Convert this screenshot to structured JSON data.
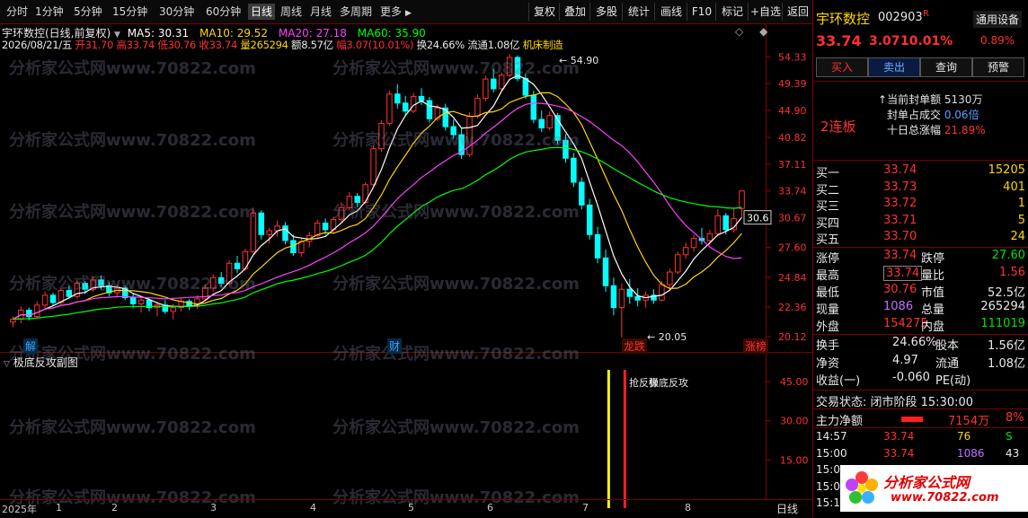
{
  "toolbar": {
    "periods": [
      "分时",
      "1分钟",
      "5分钟",
      "15分钟",
      "30分钟",
      "60分钟",
      "日线",
      "周线",
      "月线",
      "多周期",
      "更多"
    ],
    "active": "日线",
    "more_arrow": "▶",
    "actions": [
      "复权",
      "叠加",
      "多股",
      "统计",
      "画线",
      "F10",
      "标记",
      "+自选",
      "返回"
    ]
  },
  "chart": {
    "title": "宇环数控(日线,前复权)",
    "ma": [
      {
        "label": "MA5: 30.31",
        "color": "#ffffff"
      },
      {
        "label": "MA10: 29.52",
        "color": "#ffd700"
      },
      {
        "label": "MA20: 27.18",
        "color": "#ff40ff"
      },
      {
        "label": "MA60: 35.90",
        "color": "#00ff00"
      }
    ],
    "info_date": "2026/08/21/五",
    "info_open": "开31.70",
    "info_high": "高33.74",
    "info_low": "低30.76",
    "info_close": "收33.74",
    "info_vol": "量265294",
    "info_amt": "额8.57亿",
    "info_amp": "幅3.07(10.01%)",
    "info_turn": "换24.66%",
    "info_float": "流通1.08亿",
    "info_sector": "机床制造",
    "price_axis": [
      "54.33",
      "49.39",
      "44.90",
      "40.82",
      "37.11",
      "33.74",
      "30.67",
      "27.60",
      "24.84",
      "22.36",
      "20.12"
    ],
    "price_axis_highlight": "30.67",
    "high_mark": "54.90",
    "low_mark": "20.05",
    "tags": [
      {
        "text": "解",
        "color": "#3aa0ff"
      },
      {
        "text": "财",
        "color": "#3aa0ff"
      },
      {
        "text": "龙跌",
        "color": "#ff3030"
      },
      {
        "text": "涨榜",
        "color": "#ff3030"
      }
    ],
    "indicator_title": "极底反攻副图",
    "indicator_axis": [
      "45.00",
      "30.00",
      "15.00"
    ],
    "indicator_label1": "抢反弹",
    "indicator_label2": "极底反攻",
    "months": [
      "2025年",
      "1",
      "2",
      "3",
      "4",
      "5",
      "6",
      "7",
      "8"
    ],
    "bottom_period": "日线",
    "watermark": "分析家公式网www.70822.com",
    "colors": {
      "up": "#ff3030",
      "down": "#00ffff",
      "ma5": "#ffffff",
      "ma10": "#ffd700",
      "ma20": "#ff40ff",
      "ma60": "#00ff00"
    }
  },
  "chart_data": {
    "type": "candlestick",
    "ylim": [
      20.05,
      54.9
    ],
    "series": [
      {
        "name": "K线",
        "values": [
          [
            21.2,
            21.6,
            20.8,
            21.4
          ],
          [
            21.4,
            22.4,
            21.1,
            22.1
          ],
          [
            22.1,
            22.3,
            21.3,
            21.6
          ],
          [
            21.6,
            22.8,
            21.4,
            22.5
          ],
          [
            22.5,
            23.6,
            22.2,
            23.3
          ],
          [
            23.3,
            23.5,
            22.4,
            22.7
          ],
          [
            22.7,
            23.9,
            22.5,
            23.7
          ],
          [
            23.7,
            24.1,
            23.0,
            23.2
          ],
          [
            23.2,
            24.6,
            23.0,
            24.3
          ],
          [
            24.3,
            24.5,
            23.4,
            23.8
          ],
          [
            23.8,
            24.9,
            23.6,
            24.6
          ],
          [
            24.6,
            25.0,
            23.8,
            24.1
          ],
          [
            24.1,
            24.4,
            23.2,
            23.5
          ],
          [
            23.5,
            24.2,
            23.1,
            23.9
          ],
          [
            23.9,
            24.1,
            22.9,
            23.1
          ],
          [
            23.1,
            23.5,
            22.3,
            22.6
          ],
          [
            22.6,
            23.2,
            21.9,
            22.9
          ],
          [
            22.9,
            23.1,
            22.0,
            22.3
          ],
          [
            22.3,
            22.8,
            21.6,
            22.5
          ],
          [
            22.5,
            22.9,
            21.8,
            22.0
          ],
          [
            22.0,
            22.6,
            21.4,
            22.3
          ],
          [
            22.3,
            23.1,
            22.0,
            22.8
          ],
          [
            22.8,
            23.0,
            22.1,
            22.4
          ],
          [
            22.4,
            23.3,
            22.2,
            23.0
          ],
          [
            23.0,
            24.2,
            22.8,
            23.9
          ],
          [
            23.9,
            25.1,
            23.6,
            24.8
          ],
          [
            24.8,
            25.3,
            24.0,
            24.3
          ],
          [
            24.3,
            26.4,
            24.1,
            26.1
          ],
          [
            26.1,
            26.8,
            25.2,
            25.6
          ],
          [
            25.6,
            27.5,
            25.4,
            27.2
          ],
          [
            27.2,
            31.8,
            27.0,
            31.2
          ],
          [
            31.2,
            31.5,
            28.4,
            28.9
          ],
          [
            28.9,
            29.6,
            28.0,
            29.3
          ],
          [
            29.3,
            30.4,
            28.7,
            29.8
          ],
          [
            29.8,
            30.2,
            27.9,
            28.3
          ],
          [
            28.3,
            28.9,
            26.8,
            27.1
          ],
          [
            27.1,
            28.6,
            26.7,
            28.2
          ],
          [
            28.2,
            29.2,
            27.6,
            28.8
          ],
          [
            28.8,
            30.5,
            28.5,
            30.1
          ],
          [
            30.1,
            30.6,
            28.9,
            29.4
          ],
          [
            29.4,
            30.8,
            29.1,
            30.5
          ],
          [
            30.5,
            32.4,
            30.2,
            31.8
          ],
          [
            31.8,
            33.6,
            31.5,
            33.1
          ],
          [
            33.1,
            33.5,
            31.9,
            32.4
          ],
          [
            32.4,
            34.8,
            32.2,
            34.5
          ],
          [
            34.5,
            39.6,
            34.3,
            39.2
          ],
          [
            39.2,
            43.4,
            38.8,
            42.9
          ],
          [
            42.9,
            48.2,
            42.5,
            47.6
          ],
          [
            47.6,
            49.3,
            45.2,
            46.1
          ],
          [
            46.1,
            47.3,
            44.1,
            44.8
          ],
          [
            44.8,
            47.8,
            44.5,
            47.2
          ],
          [
            47.2,
            48.6,
            45.8,
            46.5
          ],
          [
            46.5,
            47.1,
            43.0,
            43.6
          ],
          [
            43.6,
            45.9,
            43.2,
            45.3
          ],
          [
            45.3,
            46.0,
            41.8,
            42.4
          ],
          [
            42.4,
            43.5,
            40.6,
            41.2
          ],
          [
            41.2,
            42.2,
            37.8,
            38.4
          ],
          [
            38.4,
            44.6,
            38.1,
            44.0
          ],
          [
            44.0,
            47.5,
            43.6,
            46.9
          ],
          [
            46.9,
            50.8,
            46.4,
            50.2
          ],
          [
            50.2,
            52.0,
            47.9,
            48.5
          ],
          [
            48.5,
            51.4,
            48.1,
            50.9
          ],
          [
            50.9,
            54.9,
            50.5,
            54.2
          ],
          [
            54.2,
            54.6,
            49.8,
            50.3
          ],
          [
            50.3,
            51.2,
            46.8,
            47.4
          ],
          [
            47.4,
            48.2,
            42.9,
            43.5
          ],
          [
            43.5,
            44.9,
            41.6,
            42.2
          ],
          [
            42.2,
            44.7,
            41.9,
            44.1
          ],
          [
            44.1,
            44.5,
            39.8,
            40.4
          ],
          [
            40.4,
            41.3,
            37.3,
            37.9
          ],
          [
            37.9,
            38.6,
            34.2,
            34.8
          ],
          [
            34.8,
            35.4,
            31.6,
            32.1
          ],
          [
            32.1,
            32.8,
            28.4,
            28.9
          ],
          [
            28.9,
            29.7,
            26.1,
            26.6
          ],
          [
            26.6,
            27.4,
            23.6,
            24.1
          ],
          [
            24.1,
            24.8,
            21.7,
            22.3
          ],
          [
            22.3,
            24.3,
            20.05,
            23.8
          ],
          [
            23.8,
            24.7,
            22.6,
            23.2
          ],
          [
            23.2,
            23.9,
            22.4,
            22.9
          ],
          [
            22.9,
            23.6,
            22.3,
            23.3
          ],
          [
            23.3,
            23.8,
            22.6,
            22.9
          ],
          [
            22.9,
            24.5,
            22.8,
            24.2
          ],
          [
            24.2,
            25.6,
            23.9,
            25.3
          ],
          [
            25.3,
            27.2,
            25.1,
            26.9
          ],
          [
            26.9,
            28.1,
            26.5,
            27.6
          ],
          [
            27.6,
            28.9,
            27.2,
            28.5
          ],
          [
            28.5,
            29.6,
            27.9,
            28.3
          ],
          [
            28.3,
            29.4,
            27.8,
            29.0
          ],
          [
            29.0,
            31.6,
            28.7,
            30.9
          ],
          [
            30.9,
            31.2,
            28.9,
            29.4
          ],
          [
            29.4,
            31.8,
            29.1,
            30.6
          ],
          [
            31.7,
            33.74,
            30.76,
            33.74
          ]
        ]
      }
    ],
    "indicator": {
      "labels": [
        "抢反弹",
        "极底反攻"
      ],
      "ylim": [
        0,
        55
      ]
    }
  },
  "panel": {
    "name": "宇环数控",
    "code": "002903",
    "code_flag": "R",
    "settings": "通用设备",
    "price": "33.74",
    "change": "3.07",
    "pct": "10.01%",
    "sector_pct": "0.89%",
    "buttons": [
      "买入",
      "卖出",
      "查询",
      "预警"
    ],
    "lianban": "2连板",
    "seal_rows": [
      {
        "k": "当前封单额",
        "v": "5130万"
      },
      {
        "k": "封单占成交",
        "v": "0.06倍"
      },
      {
        "k": "十日总涨幅",
        "v": "21.89%"
      }
    ],
    "bids": [
      {
        "k": "买一",
        "p": "33.74",
        "v": "15205"
      },
      {
        "k": "买二",
        "p": "33.73",
        "v": "401"
      },
      {
        "k": "买三",
        "p": "33.72",
        "v": "1"
      },
      {
        "k": "买四",
        "p": "33.71",
        "v": "5"
      },
      {
        "k": "买五",
        "p": "33.70",
        "v": "24"
      }
    ],
    "quote": [
      {
        "k1": "涨停",
        "v1": "33.74",
        "k2": "跌停",
        "v2": "27.60"
      },
      {
        "k1": "最高",
        "v1": "33.74",
        "k2": "量比",
        "v2": "1.56"
      },
      {
        "k1": "最低",
        "v1": "30.76",
        "k2": "市值",
        "v2": "52.5亿"
      },
      {
        "k1": "现量",
        "v1": "1086",
        "k2": "总量",
        "v2": "265294"
      },
      {
        "k1": "外盘",
        "v1": "154275",
        "k2": "内盘",
        "v2": "111019"
      }
    ],
    "fin": [
      {
        "k1": "换手",
        "v1": "24.66%",
        "k2": "股本",
        "v2": "1.56亿"
      },
      {
        "k1": "净资",
        "v1": "4.97",
        "k2": "流通",
        "v2": "1.08亿"
      },
      {
        "k1": "收益(一)",
        "v1": "-0.060",
        "k2": "PE(动)",
        "v2": ""
      }
    ],
    "status": "交易状态: 闭市阶段 15:30:00",
    "main_force_label": "主力净额",
    "main_force_value": "7154万",
    "main_force_pct": "8%",
    "ticks": [
      {
        "t": "14:57",
        "p": "33.74",
        "v": "76",
        "f": "S"
      },
      {
        "t": "15:00",
        "p": "33.74",
        "v": "1086",
        "f": "43"
      },
      {
        "t": "15:00",
        "p": "",
        "v": "",
        "f": ""
      },
      {
        "t": "15:00",
        "p": "",
        "v": "",
        "f": ""
      },
      {
        "t": "15:1",
        "p": "",
        "v": "",
        "f": ""
      }
    ],
    "logo_text": "分析家公式网",
    "logo_url": "www.70822.com"
  }
}
